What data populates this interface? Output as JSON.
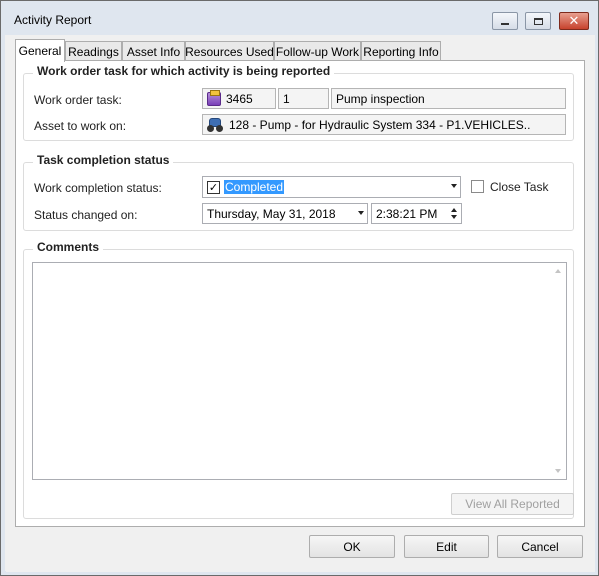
{
  "window": {
    "title": "Activity Report"
  },
  "tabs": [
    {
      "label": "General",
      "active": true
    },
    {
      "label": "Readings"
    },
    {
      "label": "Asset Info"
    },
    {
      "label": "Resources Used"
    },
    {
      "label": "Follow-up Work"
    },
    {
      "label": "Reporting Info"
    }
  ],
  "work_order_group": {
    "title": "Work order task for which activity is being reported",
    "task_label": "Work order task:",
    "task_number": "3465",
    "task_seq": "1",
    "task_description": "Pump inspection",
    "asset_label": "Asset to work on:",
    "asset_value": "128 - Pump - for Hydraulic System 334 - P1.VEHICLES.."
  },
  "task_completion_group": {
    "title": "Task completion status",
    "status_label": "Work completion status:",
    "status_value": "Completed",
    "status_checked": true,
    "close_task_label": "Close Task",
    "close_task_checked": false,
    "changed_on_label": "Status changed on:",
    "changed_date": "Thursday, May 31, 2018",
    "changed_time": "2:38:21 PM"
  },
  "comments_group": {
    "title": "Comments",
    "text": ""
  },
  "buttons": {
    "view_all_reported": "View All Reported",
    "ok": "OK",
    "edit": "Edit",
    "cancel": "Cancel"
  },
  "colors": {
    "selection": "#3399ff",
    "title_bar": "#dfe6ef",
    "close_button": "#c7422d"
  }
}
